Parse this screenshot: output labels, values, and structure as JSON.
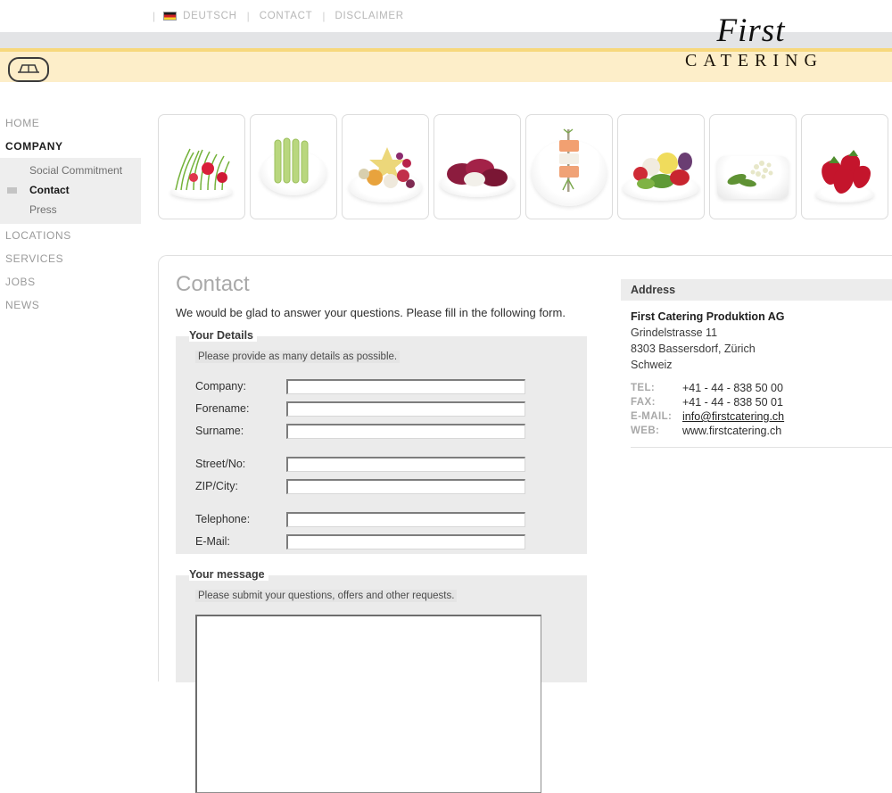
{
  "topnav": {
    "language_label": "DEUTSCH",
    "items": [
      {
        "label": "CONTACT"
      },
      {
        "label": "DISCLAIMER"
      }
    ],
    "separator": "|"
  },
  "logo": {
    "script_word": "First",
    "caps_word": "CATERING"
  },
  "sidebar": {
    "items": [
      {
        "label": "HOME",
        "active": false
      },
      {
        "label": "COMPANY",
        "active": true
      },
      {
        "label": "LOCATIONS",
        "active": false
      },
      {
        "label": "SERVICES",
        "active": false
      },
      {
        "label": "JOBS",
        "active": false
      },
      {
        "label": "NEWS",
        "active": false
      }
    ],
    "submenu": [
      {
        "label": "Social Commitment",
        "active": false
      },
      {
        "label": "Contact",
        "active": true
      },
      {
        "label": "Press",
        "active": false
      }
    ]
  },
  "gallery": {
    "items": [
      {
        "name": "chives-and-radishes"
      },
      {
        "name": "green-asparagus"
      },
      {
        "name": "fruit-and-flower-salad"
      },
      {
        "name": "radicchio-leaves"
      },
      {
        "name": "salmon-skewer"
      },
      {
        "name": "mixed-vegetables"
      },
      {
        "name": "elderflower-and-rocket"
      },
      {
        "name": "strawberries"
      }
    ]
  },
  "main": {
    "title": "Contact",
    "intro": "We would be glad to answer your questions. Please fill in the following form.",
    "details": {
      "legend": "Your Details",
      "hint": "Please provide as many details as possible.",
      "fields": [
        {
          "label": "Company:",
          "value": "",
          "name": "company"
        },
        {
          "label": "Forename:",
          "value": "",
          "name": "forename"
        },
        {
          "label": "Surname:",
          "value": "",
          "name": "surname"
        },
        {
          "label": "Street/No:",
          "value": "",
          "name": "street"
        },
        {
          "label": "ZIP/City:",
          "value": "",
          "name": "zip-city"
        },
        {
          "label": "Telephone:",
          "value": "",
          "name": "telephone"
        },
        {
          "label": "E-Mail:",
          "value": "",
          "name": "email"
        }
      ]
    },
    "message": {
      "legend": "Your message",
      "hint": "Please submit your questions, offers and other requests.",
      "value": ""
    }
  },
  "address": {
    "heading": "Address",
    "company": "First Catering Produktion AG",
    "street": "Grindelstrasse 11",
    "city": "8303 Bassersdorf, Zürich",
    "country": "Schweiz",
    "contacts": [
      {
        "key": "TEL:",
        "value": "+41 - 44 - 838 50 00",
        "link": false
      },
      {
        "key": "FAX:",
        "value": "+41 - 44 - 838 50 01",
        "link": false
      },
      {
        "key": "E-MAIL:",
        "value": "info@firstcatering.ch",
        "link": true
      },
      {
        "key": "WEB:",
        "value": "www.firstcatering.ch",
        "link": false
      }
    ]
  },
  "colors": {
    "band_gray": "#e3e4e6",
    "band_gold": "#f7d87c",
    "band_cream": "#fdeec9",
    "panel_fill": "#ebebeb",
    "muted_text": "#9a9a9a"
  }
}
